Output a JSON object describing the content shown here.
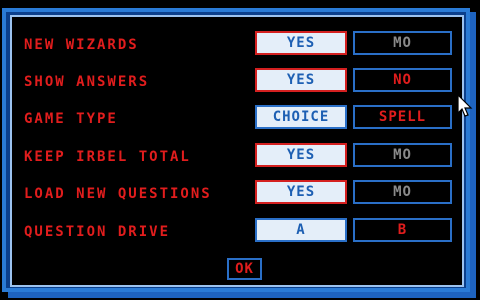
{
  "settings": {
    "rows": [
      {
        "label": "NEW WIZARDS",
        "left": "YES",
        "right": "MO"
      },
      {
        "label": "SHOW ANSWERS",
        "left": "YES",
        "right": "NO"
      },
      {
        "label": "GAME TYPE",
        "left": "CHOICE",
        "right": "SPELL"
      },
      {
        "label": "KEEP IRBEL TOTAL",
        "left": "YES",
        "right": "MO"
      },
      {
        "label": "LOAD NEW QUESTIONS",
        "left": "YES",
        "right": "MO"
      },
      {
        "label": "QUESTION DRIVE",
        "left": "A",
        "right": "B"
      }
    ]
  },
  "dialog": {
    "ok_label": "OK"
  },
  "colors": {
    "label": "#e11d1d",
    "selected_bg": "#e4eef9",
    "selected_text": "#1d5fb3",
    "border_blue": "#2a6fc7",
    "frame_blue": "#2a7bd6"
  },
  "icons": {
    "cursor": "mouse-pointer-icon"
  }
}
